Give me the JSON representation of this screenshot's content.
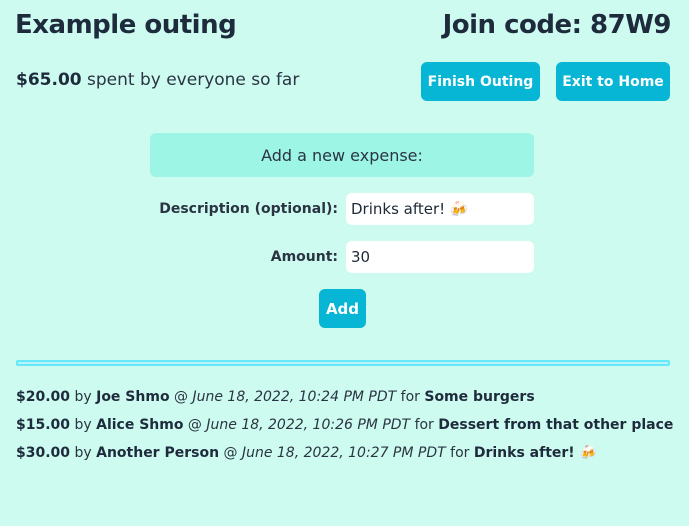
{
  "header": {
    "title": "Example outing",
    "join_code": "Join code: 87W9"
  },
  "summary": {
    "total": "$65.00",
    "text": "spent by everyone so far"
  },
  "actions": {
    "finish_label": "Finish Outing",
    "exit_label": "Exit to Home"
  },
  "form": {
    "heading": "Add a new expense:",
    "description_label": "Description (optional):",
    "description_value": "Drinks after! 🍻",
    "amount_label": "Amount:",
    "amount_value": "30",
    "add_label": "Add"
  },
  "expenses": [
    {
      "amount": "$20.00",
      "by": "by",
      "person": "Joe Shmo",
      "at": "@",
      "time": "June 18, 2022, 10:24 PM PDT",
      "for": "for",
      "description": "Some burgers"
    },
    {
      "amount": "$15.00",
      "by": "by",
      "person": "Alice Shmo",
      "at": "@",
      "time": "June 18, 2022, 10:26 PM PDT",
      "for": "for",
      "description": "Dessert from that other place"
    },
    {
      "amount": "$30.00",
      "by": "by",
      "person": "Another Person",
      "at": "@",
      "time": "June 18, 2022, 10:27 PM PDT",
      "for": "for",
      "description": "Drinks after! 🍻"
    }
  ],
  "colors": {
    "background": "#cdfbf0",
    "accent": "#06b6d4",
    "form_header": "#9df5e6",
    "divider": "#67e8f9"
  }
}
